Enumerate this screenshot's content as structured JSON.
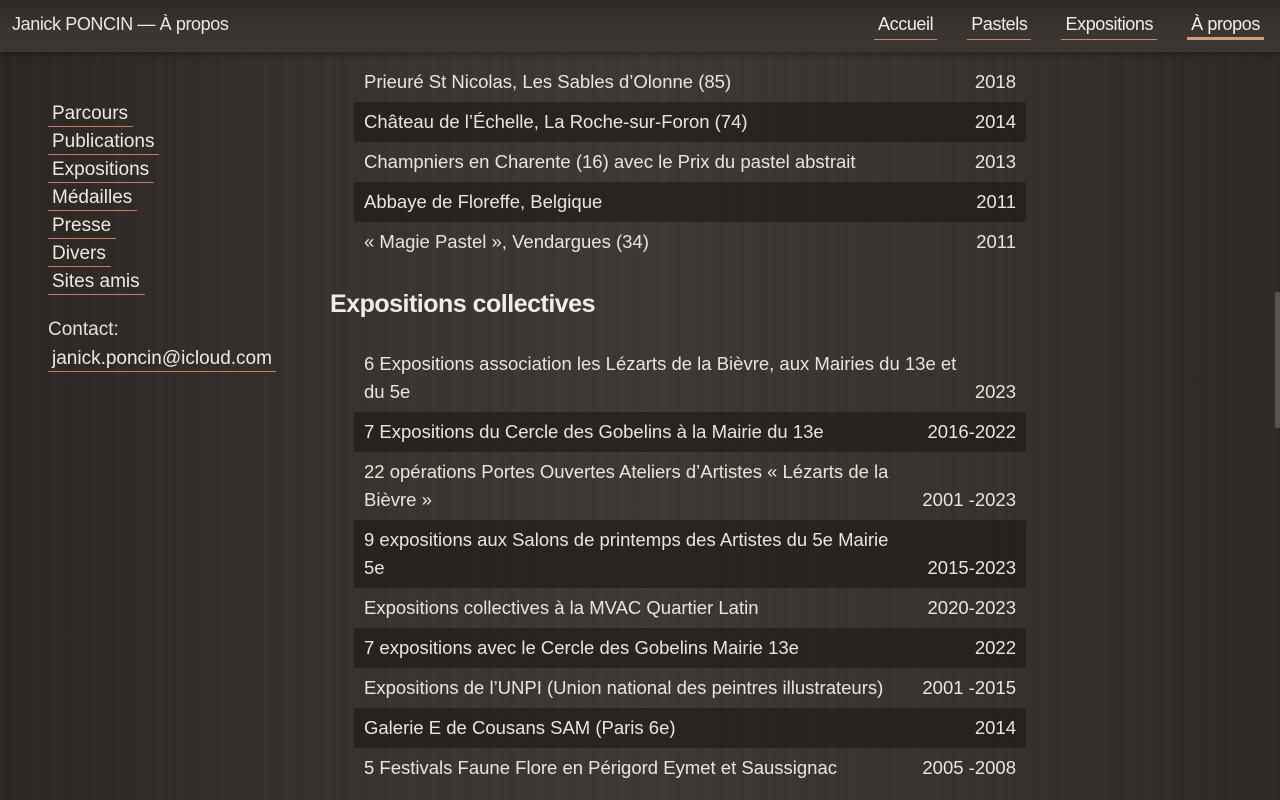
{
  "header": {
    "site_title": "Janick PONCIN — À propos",
    "nav": [
      {
        "label": "Accueil"
      },
      {
        "label": "Pastels"
      },
      {
        "label": "Expositions"
      },
      {
        "label": "À propos"
      }
    ],
    "active_nav": "À propos"
  },
  "sidebar": {
    "items": [
      {
        "label": "Parcours"
      },
      {
        "label": "Publications"
      },
      {
        "label": "Expositions"
      },
      {
        "label": "Médailles"
      },
      {
        "label": "Presse"
      },
      {
        "label": "Divers"
      },
      {
        "label": "Sites amis"
      }
    ],
    "contact_label": "Contact:",
    "contact_email": "janick.poncin@icloud.com"
  },
  "main": {
    "individual_rows": [
      {
        "text": "Prieuré St Nicolas, Les Sables d’Olonne (85)",
        "year": "2018"
      },
      {
        "text": "Château de l’Échelle, La Roche-sur-Foron (74)",
        "year": "2014"
      },
      {
        "text": "Champniers en Charente (16) avec le Prix du pastel abstrait",
        "year": "2013"
      },
      {
        "text": "Abbaye de Floreffe, Belgique",
        "year": "2011"
      },
      {
        "text": "« Magie Pastel », Vendargues (34)",
        "year": "2011"
      }
    ],
    "collective_title": "Expositions collectives",
    "collective_rows": [
      {
        "text": "6 Expositions association les Lézarts de la Bièvre, aux Mairies du 13e et du 5e",
        "year": "2023"
      },
      {
        "text": "7 Expositions du Cercle des Gobelins à la Mairie du 13e",
        "year": "2016-2022"
      },
      {
        "text": "22 opérations Portes Ouvertes Ateliers d’Artistes « Lézarts de la Bièvre »",
        "year": "2001 -2023"
      },
      {
        "text": "9 expositions aux Salons de printemps des Artistes du 5e Mairie 5e",
        "year": "2015-2023"
      },
      {
        "text": "Expositions collectives à la MVAC Quartier Latin",
        "year": "2020-2023"
      },
      {
        "text": "7 expositions avec le Cercle des Gobelins Mairie 13e",
        "year": "2022"
      },
      {
        "text": "Expositions de l’UNPI (Union national des peintres illustrateurs)",
        "year": "2001 -2015"
      },
      {
        "text": "Galerie E de Cousans SAM (Paris 6e)",
        "year": "2014"
      },
      {
        "text": "5 Festivals Faune Flore en Périgord Eymet et Saussignac",
        "year": "2005 -2008"
      }
    ]
  },
  "colors": {
    "accent_underline": "#c88a6c",
    "row_shade": "#1c1816",
    "text": "#ebe4dc"
  }
}
